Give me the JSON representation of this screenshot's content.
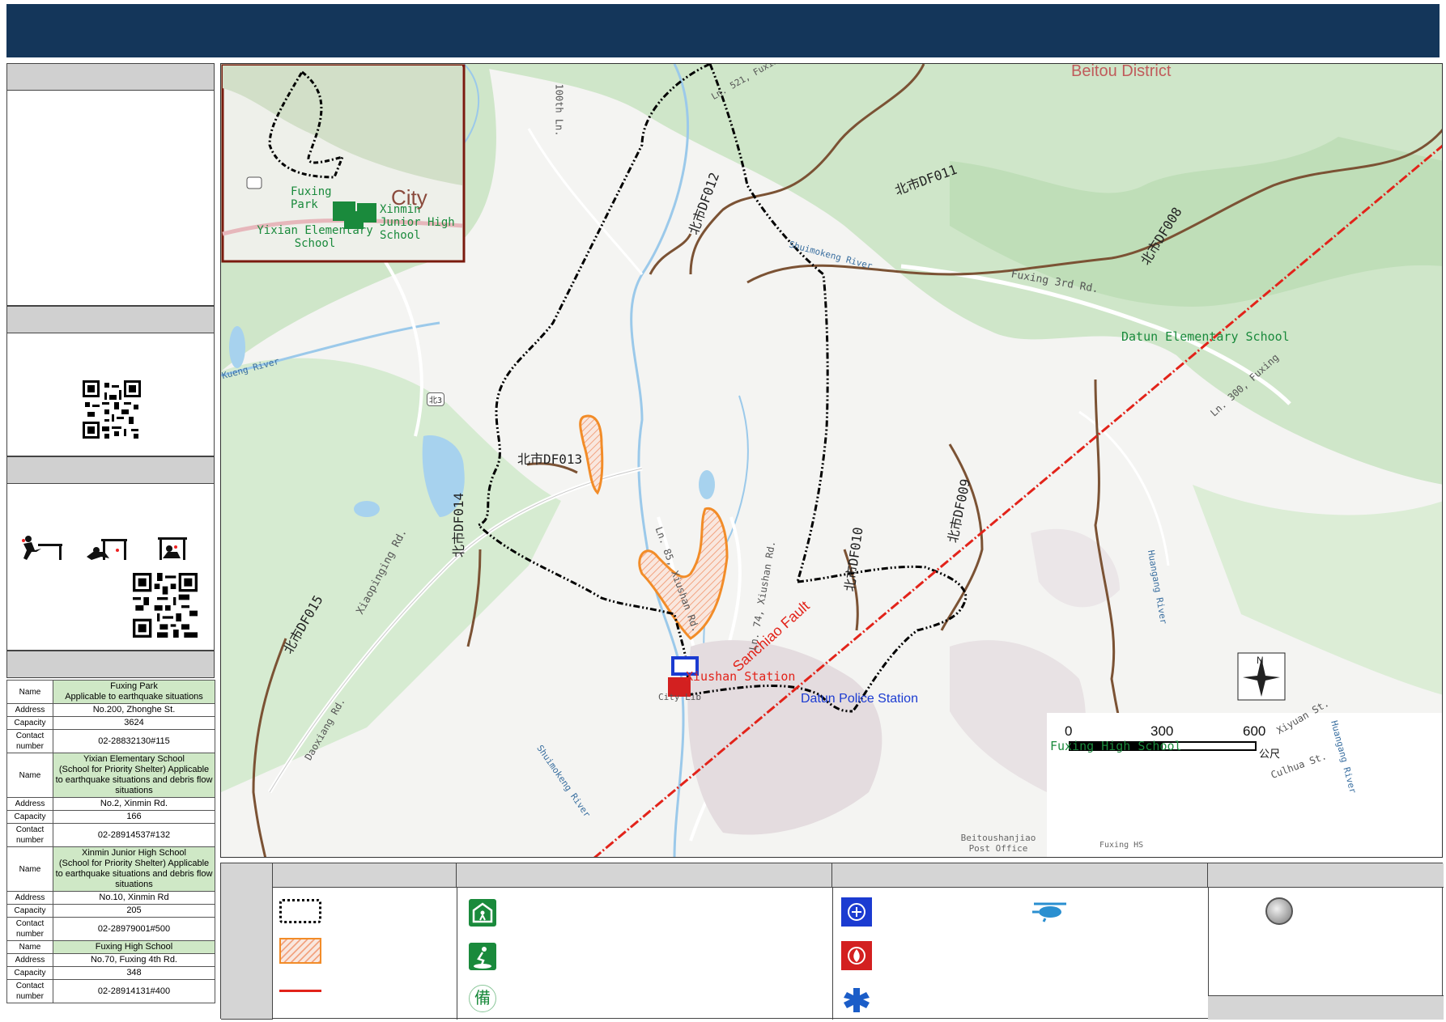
{
  "map": {
    "district_label": "Beitou District",
    "fault_label": "Sanchiao Fault",
    "roads": [
      "Xiaopinging Rd.",
      "Fuxing 3rd Rd.",
      "Ln. 300, Fuxing",
      "Ln. 85, Xiushan Rd.",
      "Ln. 74, Xiushan Rd.",
      "Daoxiang Rd.",
      "Xiyuan St.",
      "Culhua St.",
      "100th Ln.",
      "Ln. 521, Fuxing",
      "Xiaoping Rd.",
      "Daoxiang Rd."
    ],
    "rivers": [
      "Shuimokeng River",
      "Shuimokeng River",
      "Huangang River",
      "Shuimokeng River",
      "Kueng River",
      "Huangang River"
    ],
    "debris_flows": [
      "北市DF011",
      "北市DF012",
      "北市DF013",
      "北市DF014",
      "北市DF015",
      "北市DF008",
      "北市DF009",
      "北市DF010"
    ],
    "places": {
      "datun_elem": "Datun Elementary School",
      "fuxing_high": "Fuxing High School",
      "xiushan_station": "Xiushan Station",
      "datun_police": "Datun Police Station",
      "post_office": "Beitoushanjiao Post Office",
      "bei3_shield": "北3",
      "city_lib": "City Lib",
      "fuxing_hs": "Fuxing HS"
    },
    "inset": {
      "fuxing_park": "Fuxing Park",
      "yixian": "Yixian Elementary School",
      "xinmin": "Xinmin Junior High School",
      "city_text": "City"
    },
    "scale": {
      "ticks": [
        "0",
        "300",
        "600"
      ],
      "unit": "公尺"
    },
    "north": "N"
  },
  "sheltertable": {
    "labels": {
      "name": "Name",
      "address": "Address",
      "capacity": "Capacity",
      "contact": "Contact number"
    },
    "shelters": [
      {
        "name": "Fuxing Park",
        "note": "Applicable to earthquake situations",
        "address": "No.200, Zhonghe St.",
        "capacity": "3624",
        "contact": "02-28832130#115"
      },
      {
        "name": "Yixian Elementary School",
        "note": "(School for Priority Shelter) Applicable to earthquake situations and debris flow situations",
        "address": "No.2, Xinmin Rd.",
        "capacity": "166",
        "contact": "02-28914537#132"
      },
      {
        "name": "Xinmin Junior High School",
        "note": "(School for Priority Shelter) Applicable to earthquake situations and debris flow situations",
        "address": "No.10, Xinmin Rd",
        "capacity": "205",
        "contact": "02-28979001#500"
      },
      {
        "name": "Fuxing High School",
        "note": "",
        "address": "No.70, Fuxing 4th Rd.",
        "capacity": "348",
        "contact": "02-28914131#400"
      }
    ]
  },
  "legend": {
    "shelter_icon_label": "備",
    "colors": {
      "header": "#14365a",
      "fault": "#e2231a",
      "hazard": "#f28c28",
      "boundary": "#000000",
      "shelter": "#1a8a3c",
      "police": "#1b3bd1",
      "fire": "#d32020"
    }
  }
}
